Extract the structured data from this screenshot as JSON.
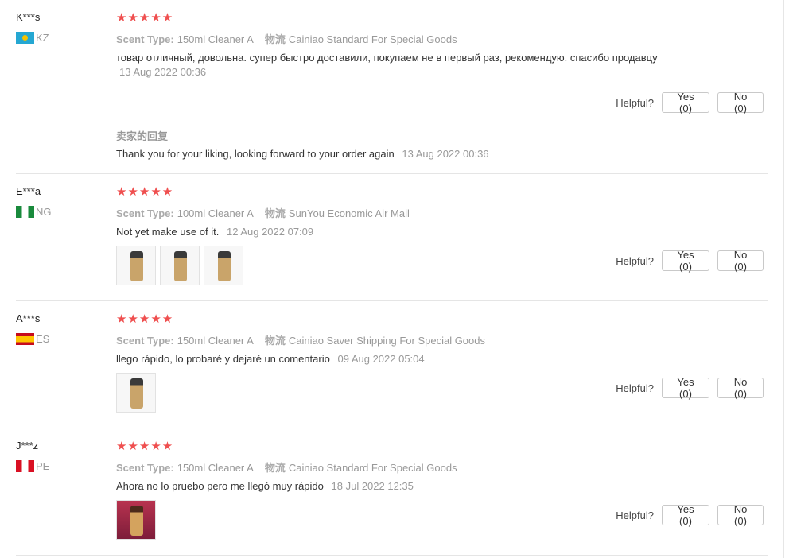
{
  "labels": {
    "scent_key": "Scent Type:",
    "logistics_key": "物流",
    "helpful": "Helpful?",
    "reply_title": "卖家的回复"
  },
  "reviews": [
    {
      "user": "K***s",
      "country": "KZ",
      "flag": "kz-flag",
      "stars": "★★★★★",
      "scent": "150ml Cleaner A",
      "logistics": "Cainiao Standard For Special Goods",
      "text": "товар отличный, довольна. супер быстро доставили, покупаем не в первый раз, рекомендую. спасибо продавцу",
      "date": "13 Aug 2022 00:36",
      "yes": "Yes (0)",
      "no": "No (0)",
      "reply": "Thank you for your liking, looking forward to your order again",
      "reply_date": "13 Aug 2022 00:36"
    },
    {
      "user": "E***a",
      "country": "NG",
      "flag": "ng-flag",
      "stars": "★★★★★",
      "scent": "100ml Cleaner A",
      "logistics": "SunYou Economic Air Mail",
      "text": "Not yet make use of it.",
      "date": "12 Aug 2022 07:09",
      "yes": "Yes (0)",
      "no": "No (0)"
    },
    {
      "user": "A***s",
      "country": "ES",
      "flag": "es-flag",
      "stars": "★★★★★",
      "scent": "150ml Cleaner A",
      "logistics": "Cainiao Saver Shipping For Special Goods",
      "text": "llego rápido, lo probaré y dejaré un comentario",
      "date": "09 Aug 2022 05:04",
      "yes": "Yes (0)",
      "no": "No (0)"
    },
    {
      "user": "J***z",
      "country": "PE",
      "flag": "pe-flag",
      "stars": "★★★★★",
      "scent": "150ml Cleaner A",
      "logistics": "Cainiao Standard For Special Goods",
      "text": "Ahora no lo pruebo pero me llegó muy rápido",
      "date": "18 Jul 2022 12:35",
      "yes": "Yes (0)",
      "no": "No (0)"
    }
  ],
  "colors": {
    "star": "#ef4f4f",
    "muted": "#999999",
    "divider": "#e5e5e5"
  }
}
